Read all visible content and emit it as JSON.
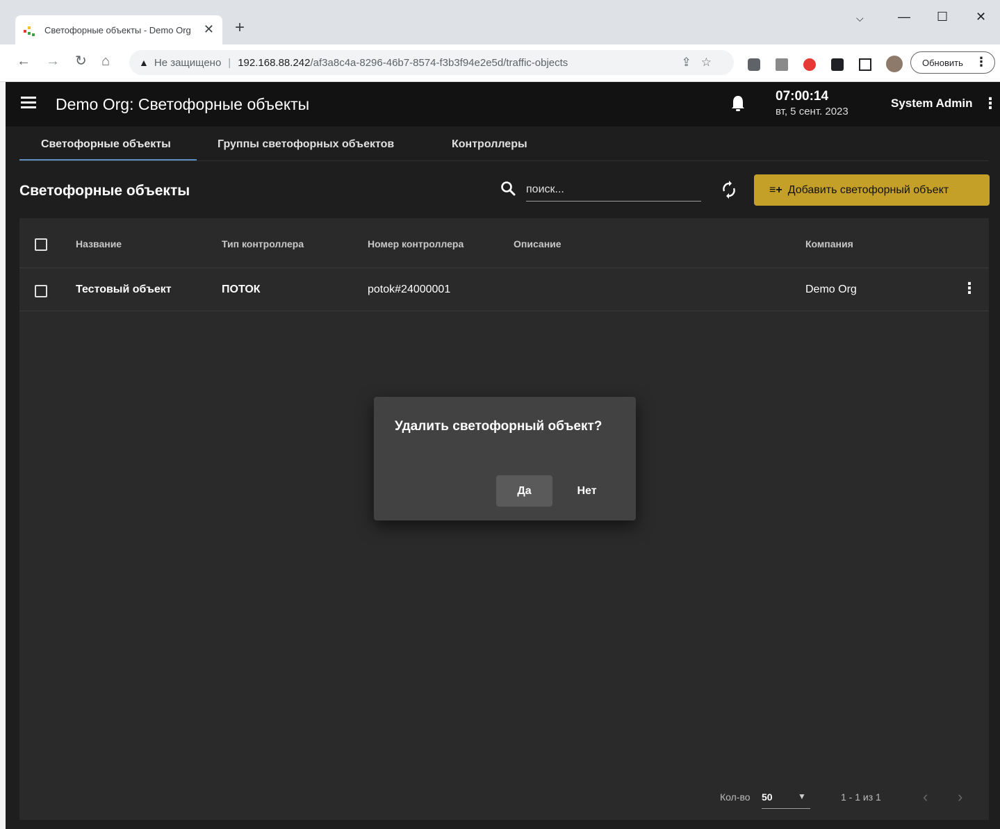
{
  "browser": {
    "tab_title": "Светофорные объекты - Demo Org",
    "address_insecure": "Не защищено",
    "address_host": "192.168.88.242",
    "address_path": "/af3a8c4a-8296-46b7-8574-f3b3f94e2e5d/traffic-objects",
    "update_button": "Обновить"
  },
  "appbar": {
    "title": "Demo Org: Светофорные объекты",
    "time": "07:00:14",
    "date": "вт, 5 сент. 2023",
    "user": "System Admin"
  },
  "tabs": [
    {
      "label": "Светофорные объекты"
    },
    {
      "label": "Группы светофорных объектов"
    },
    {
      "label": "Контроллеры"
    }
  ],
  "page": {
    "title": "Светофорные объекты",
    "search_placeholder": "поиск...",
    "add_button": "Добавить светофорный объект"
  },
  "table": {
    "columns": [
      "Название",
      "Тип контроллера",
      "Номер контроллера",
      "Описание",
      "Компания"
    ],
    "rows": [
      {
        "name": "Тестовый объект",
        "controller_type": "ПОТОК",
        "controller_number": "potok#24000001",
        "description": "",
        "company": "Demo Org"
      }
    ]
  },
  "paginator": {
    "label": "Кол-во",
    "page_size": "50",
    "range": "1 - 1 из 1"
  },
  "dialog": {
    "title": "Удалить светофорный объект?",
    "yes": "Да",
    "no": "Нет"
  },
  "colors": {
    "accent": "#c5a028",
    "tab_indicator": "#5a8fbf",
    "app_background": "#1e1e1e"
  }
}
